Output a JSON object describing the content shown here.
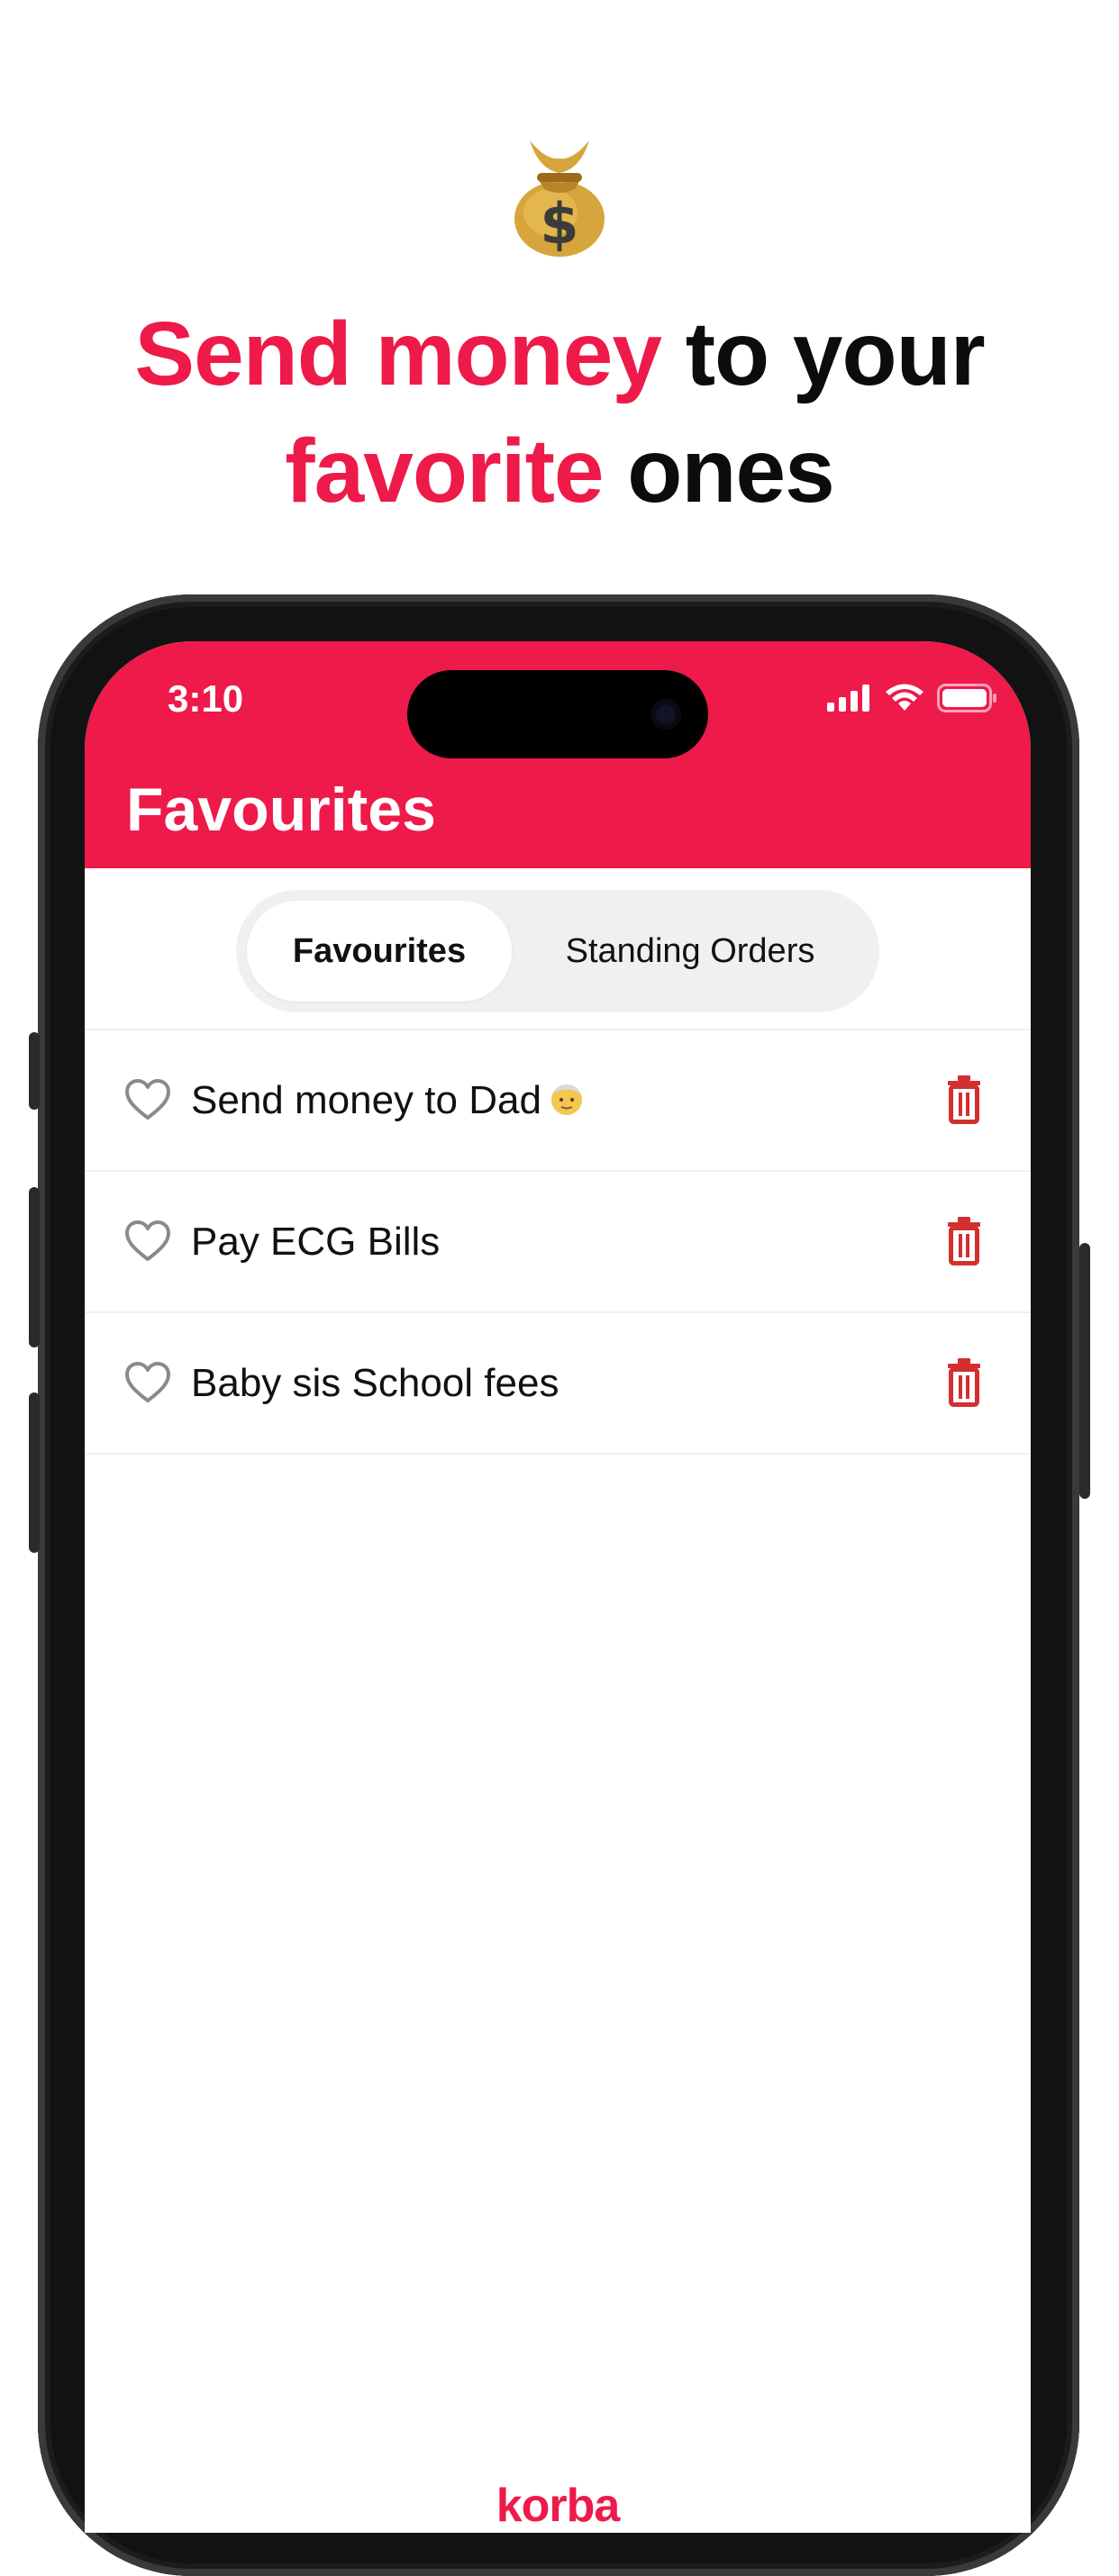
{
  "promo": {
    "emoji_icon": "money-bag-icon",
    "headline_accent_1": "Send money",
    "headline_plain_1": " to your",
    "headline_accent_2": "favorite",
    "headline_plain_2": " ones"
  },
  "status_bar": {
    "time": "3:10"
  },
  "header": {
    "title": "Favourites"
  },
  "tabs": [
    {
      "label": "Favourites",
      "active": true
    },
    {
      "label": "Standing Orders",
      "active": false
    }
  ],
  "favourites": [
    {
      "label": "Send money to Dad",
      "emoji_icon": "old-man-face-icon"
    },
    {
      "label": "Pay ECG Bills"
    },
    {
      "label": "Baby sis School fees"
    }
  ],
  "footer": {
    "brand": "korba"
  },
  "colors": {
    "accent": "#ed1a4a",
    "delete": "#d32f2f"
  }
}
